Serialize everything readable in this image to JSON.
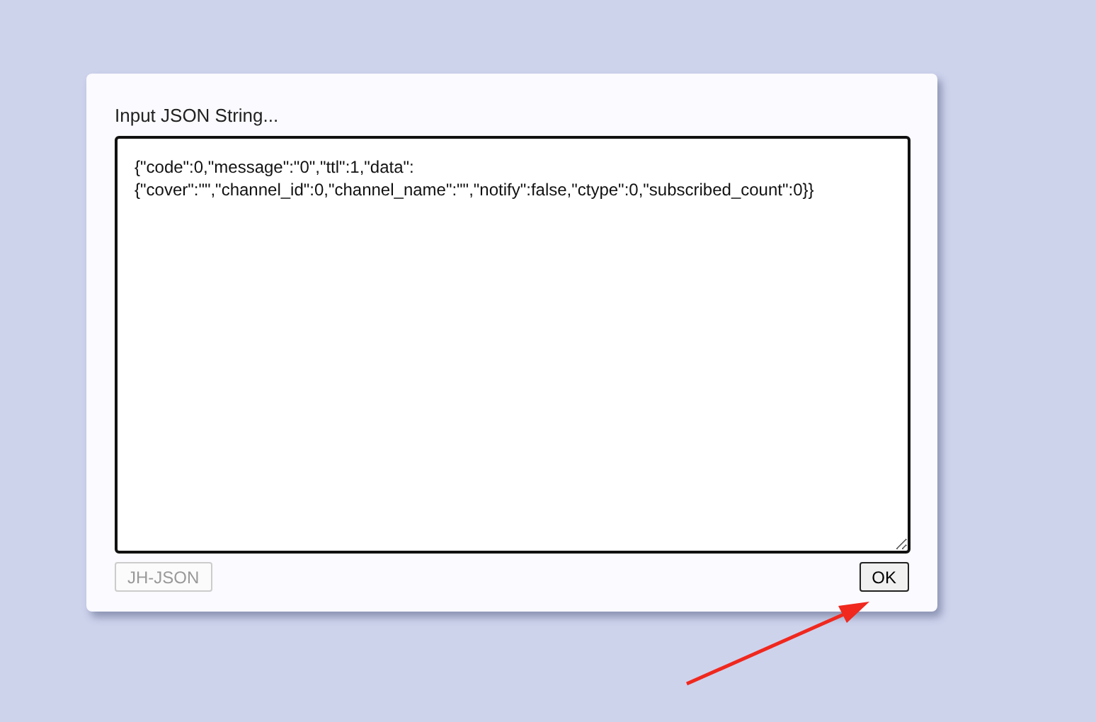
{
  "dialog": {
    "label": "Input JSON String...",
    "input": {
      "value": "{\"code\":0,\"message\":\"0\",\"ttl\":1,\"data\":{\"cover\":\"\",\"channel_id\":0,\"channel_name\":\"\",\"notify\":false,\"ctype\":0,\"subscribed_count\":0}}"
    },
    "buttons": [
      {
        "label": "JH-JSON",
        "disabled": true
      },
      {
        "label": "OK",
        "disabled": false
      }
    ]
  }
}
